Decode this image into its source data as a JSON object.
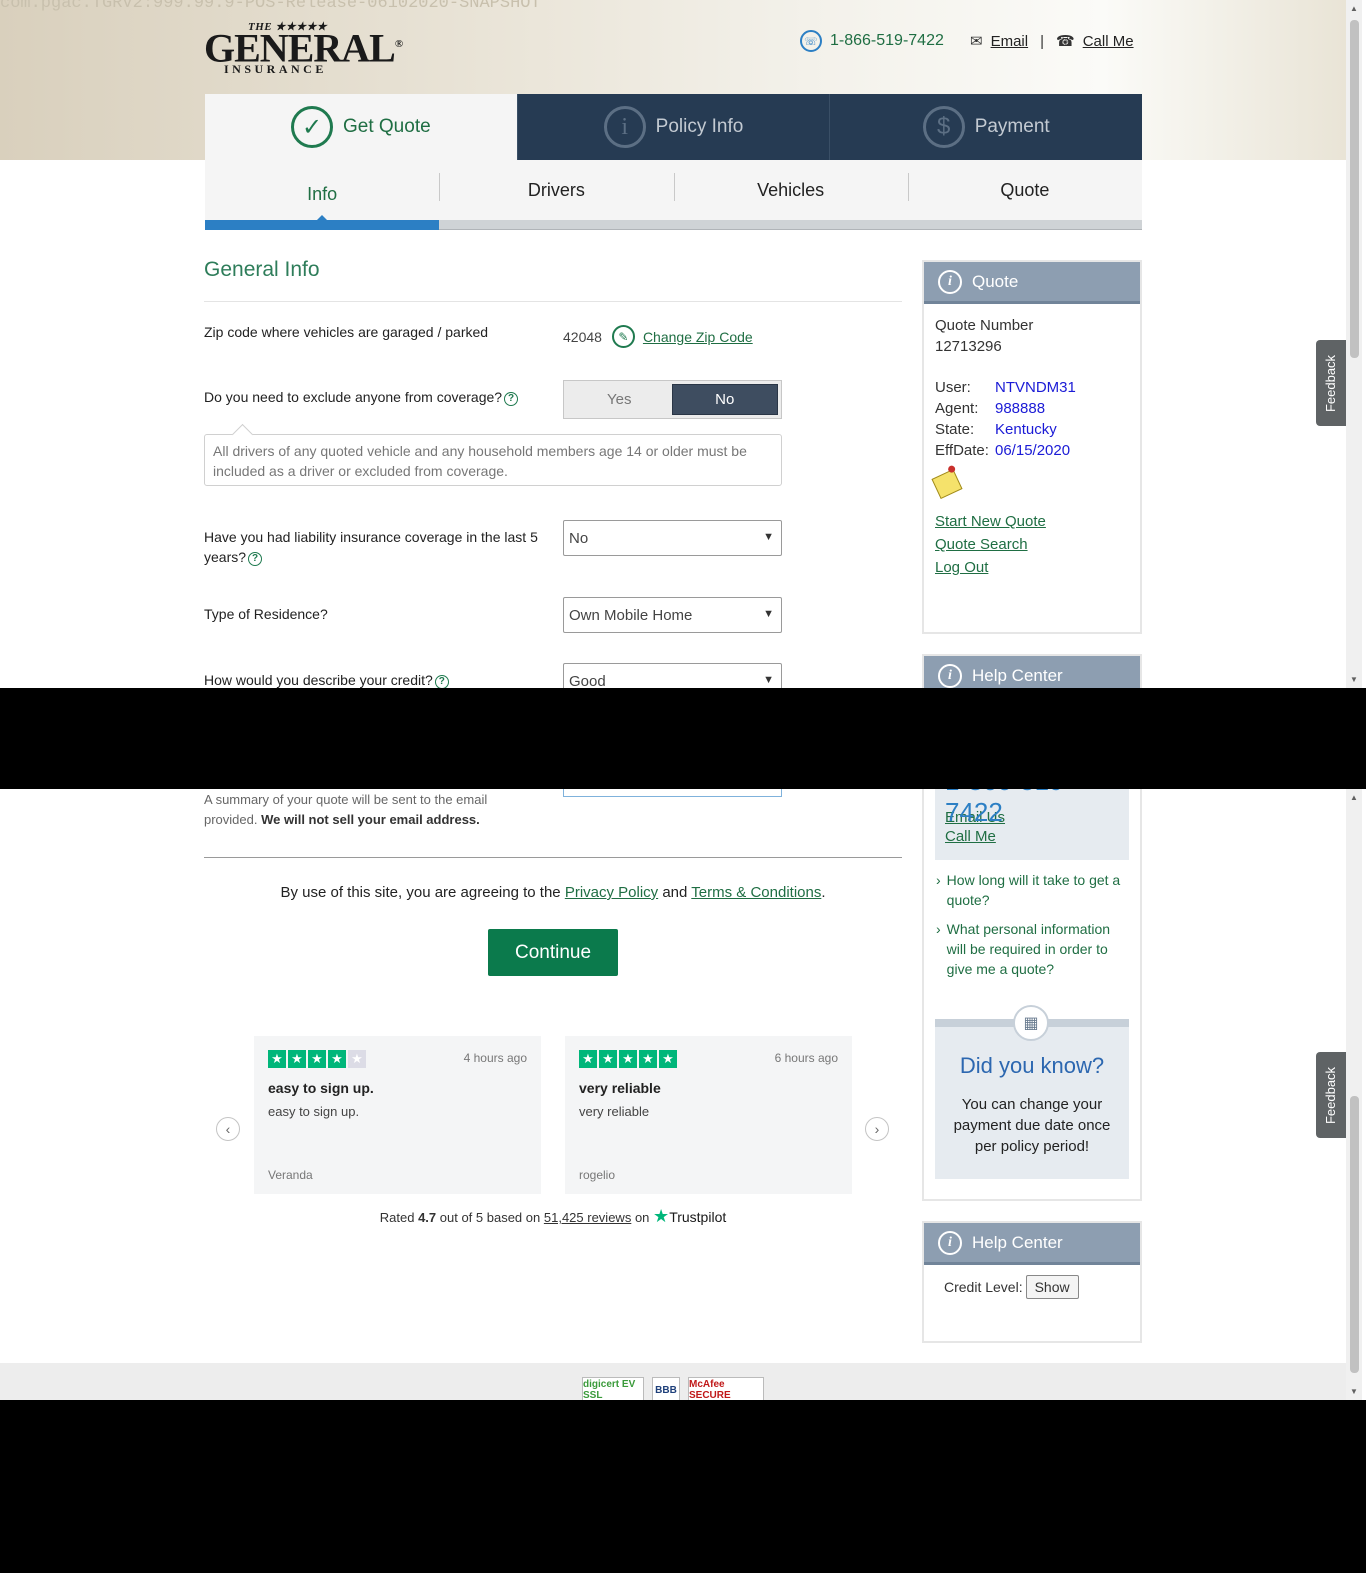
{
  "build_tag": "com.pgac.TGRV2:999.99.9-POS-Release-06102020-SNAPSHOT",
  "logo": {
    "the": "THE ★★★★★",
    "main": "GENERAL",
    "reg": "®",
    "sub": "INSURANCE"
  },
  "contact": {
    "phone": "1-866-519-7422",
    "email": "Email",
    "call": "Call Me",
    "sep": "|"
  },
  "steps": [
    {
      "label": "Get Quote",
      "icon": "✓"
    },
    {
      "label": "Policy Info",
      "icon": "i"
    },
    {
      "label": "Payment",
      "icon": "$"
    }
  ],
  "subtabs": [
    "Info",
    "Drivers",
    "Vehicles",
    "Quote"
  ],
  "form": {
    "section_title": "General Info",
    "zip": {
      "label": "Zip code where vehicles are garaged / parked",
      "value": "42048",
      "change_link": "Change Zip Code"
    },
    "exclude": {
      "label": "Do you need to exclude anyone from coverage?",
      "yes": "Yes",
      "no": "No",
      "notice": "All drivers of any quoted vehicle and any household members age 14 or older must be included as a driver or excluded from coverage."
    },
    "liability": {
      "label": "Have you had liability insurance coverage in the last 5 years?",
      "value": "No"
    },
    "residence": {
      "label": "Type of Residence?",
      "value": "Own Mobile Home"
    },
    "credit": {
      "label": "How would you describe your credit?",
      "value": "Good"
    },
    "email_note": "A summary of your quote will be sent to the email provided.",
    "email_note_bold": "We will not sell your email address.",
    "agree_prefix": "By use of this site, you are agreeing to the",
    "privacy": "Privacy Policy",
    "and": "and",
    "terms": "Terms & Conditions",
    "period": ".",
    "continue": "Continue"
  },
  "quote_panel": {
    "title": "Quote",
    "number_label": "Quote Number",
    "number": "12713296",
    "user_label": "User:",
    "user": "NTVNDM31",
    "agent_label": "Agent:",
    "agent": "988888",
    "state_label": "State:",
    "state": "Kentucky",
    "eff_label": "EffDate:",
    "eff": "06/15/2020",
    "links": [
      "Start New Quote",
      "Quote Search",
      "Log Out"
    ]
  },
  "help_center": {
    "title": "Help Center",
    "phone": "1-866-519-7422",
    "email_us": "Email Us",
    "call_me": "Call Me",
    "faqs": [
      "How long will it take to get a quote?",
      "What personal information will be required in order to give me a quote?"
    ],
    "did_you_know_title": "Did you know?",
    "did_you_know_text": "You can change your payment due date once per policy period!"
  },
  "help_center2": {
    "title": "Help Center",
    "credit_label": "Credit Level:",
    "show": "Show"
  },
  "reviews": [
    {
      "stars": 4,
      "time": "4 hours ago",
      "title": "easy to sign up.",
      "body": "easy to sign up.",
      "author": "Veranda"
    },
    {
      "stars": 5,
      "time": "6 hours ago",
      "title": "very reliable",
      "body": "very reliable",
      "author": "rogelio"
    }
  ],
  "trustpilot": {
    "rated": "Rated",
    "score": "4.7",
    "out_of": "out of 5 based on",
    "count": "51,425 reviews",
    "on": "on",
    "brand": "Trustpilot"
  },
  "feedback": "Feedback",
  "badges": [
    "digicert EV SSL",
    "BBB",
    "McAfee SECURE"
  ],
  "colors": {
    "primary_green": "#0b7a4c",
    "nav_dark": "#263b53",
    "accent_blue": "#2c7fc4",
    "panel_head": "#8d9eb1"
  }
}
